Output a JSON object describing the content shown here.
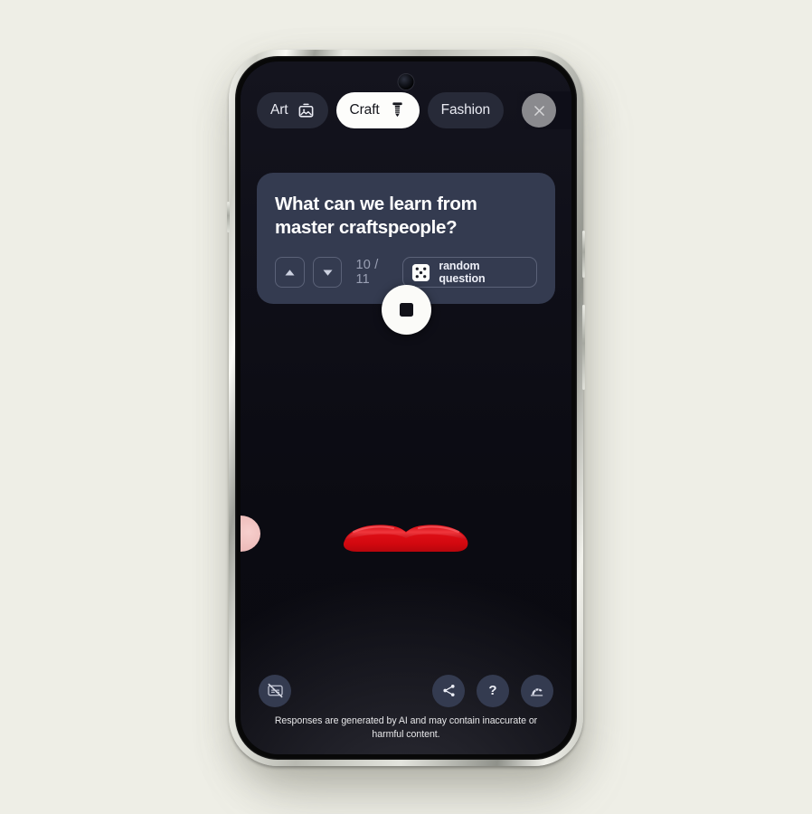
{
  "app": {
    "background_color": "#eeeee6",
    "screen_background": "#0d0d16",
    "accent_card_color": "#343b50",
    "lips_color": "#e21019"
  },
  "topbar": {
    "chips": [
      {
        "label": "Art",
        "icon": "image-frame-icon",
        "active": false
      },
      {
        "label": "Craft",
        "icon": "screw-icon",
        "active": true
      },
      {
        "label": "Fashion",
        "icon": "none",
        "active": false
      }
    ],
    "close_label": "close-icon"
  },
  "card": {
    "question": "What can we learn from master craftspeople?",
    "prev_label": "previous-question",
    "next_label": "next-question",
    "counter": "10 / 11",
    "random_label": "random question",
    "dice_icon": "dice-five-icon"
  },
  "record": {
    "state": "recording",
    "icon": "stop-square-icon"
  },
  "bottom": {
    "captions_icon": "closed-captions-off-icon",
    "share_icon": "share-icon",
    "help_icon": "question-mark-icon",
    "help_label": "?",
    "feedback_icon": "hand-wave-icon"
  },
  "disclaimer": "Responses are generated by AI and may contain inaccurate or harmful content."
}
